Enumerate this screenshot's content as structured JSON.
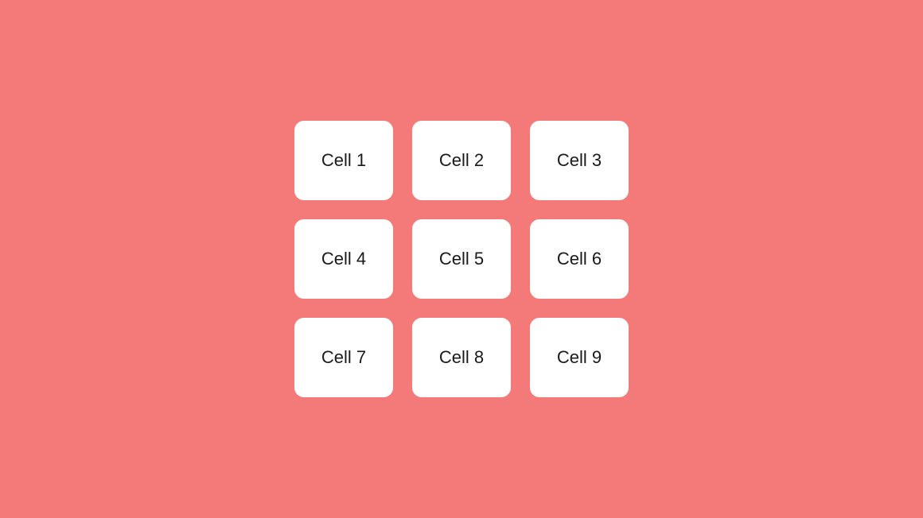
{
  "grid": {
    "cells": [
      {
        "label": "Cell 1"
      },
      {
        "label": "Cell 2"
      },
      {
        "label": "Cell 3"
      },
      {
        "label": "Cell 4"
      },
      {
        "label": "Cell 5"
      },
      {
        "label": "Cell 6"
      },
      {
        "label": "Cell 7"
      },
      {
        "label": "Cell 8"
      },
      {
        "label": "Cell 9"
      }
    ]
  },
  "colors": {
    "background": "#f47a7a",
    "cell_bg": "#ffffff",
    "cell_text": "#1a1a1a"
  }
}
